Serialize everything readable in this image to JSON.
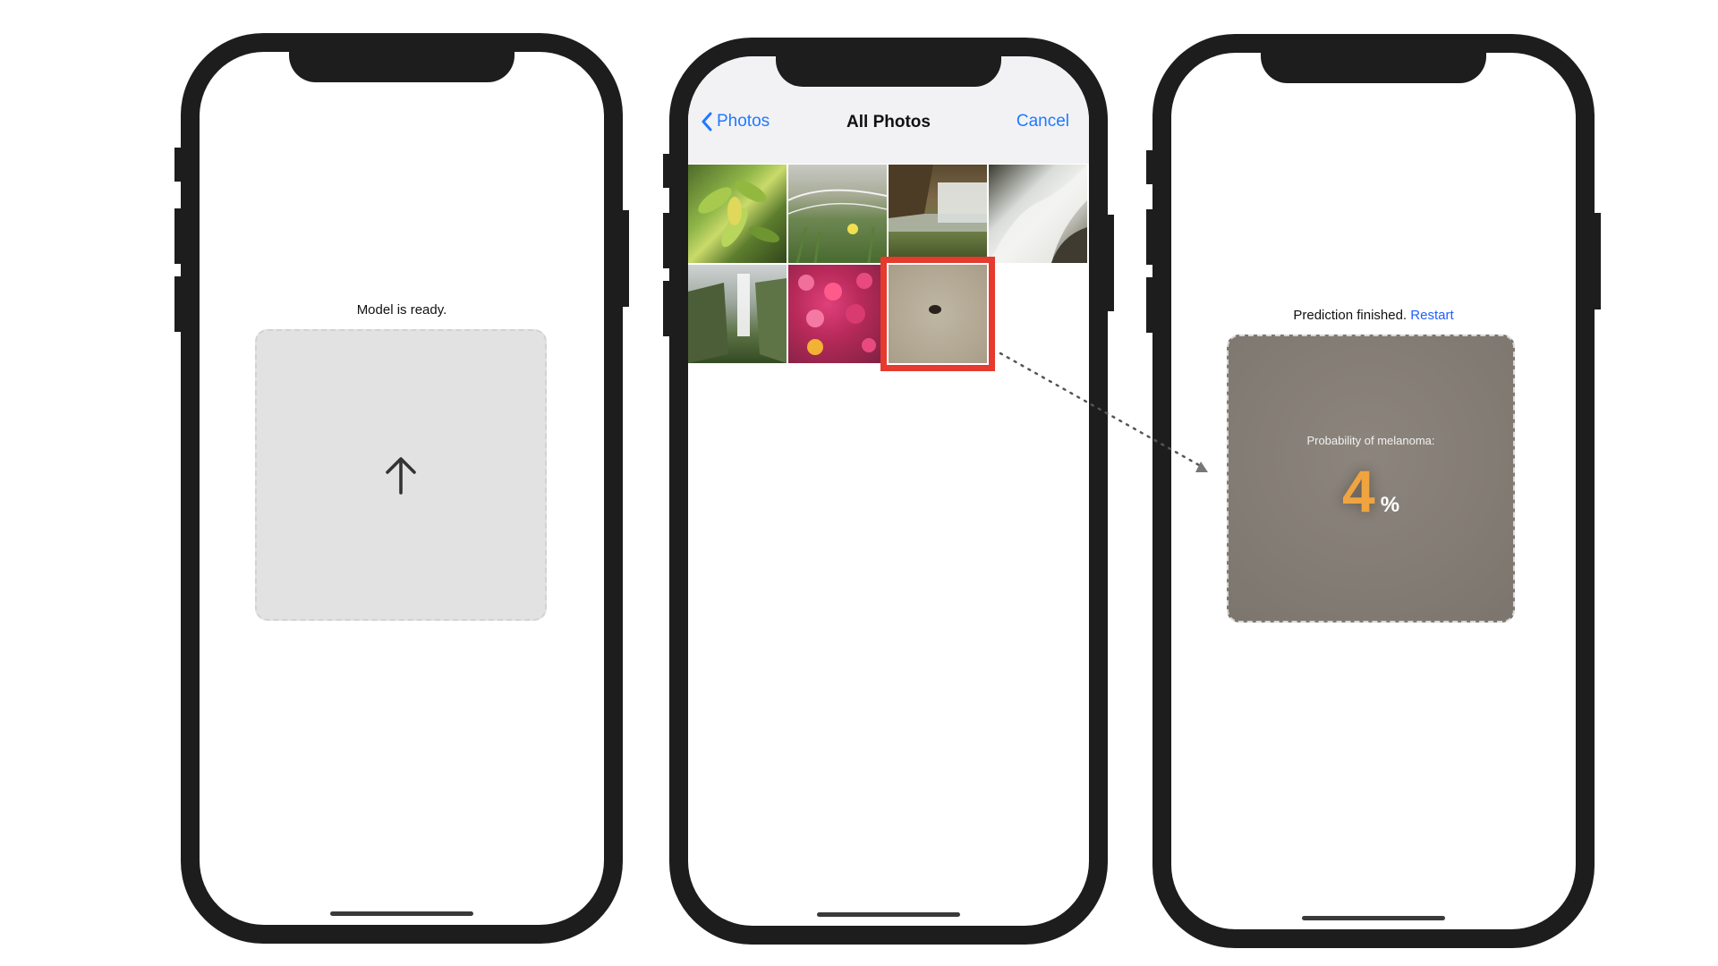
{
  "screen1": {
    "status": "Model is ready."
  },
  "screen2": {
    "back_label": "Photos",
    "title": "All Photos",
    "cancel_label": "Cancel",
    "thumbnails": [
      "plant",
      "meadow",
      "waterfall-cliff",
      "waterfall-rocks",
      "waterfall-mist",
      "flowers",
      "skin-lesion"
    ],
    "selected": "skin-lesion",
    "selection_color": "#e53a2d"
  },
  "screen3": {
    "status": "Prediction finished.",
    "restart_label": "Restart",
    "probability_label": "Probability of melanoma:",
    "probability_value": "4",
    "probability_unit": "%"
  },
  "colors": {
    "link": "#1f7aff",
    "restart_link": "#1f5fff",
    "accent_value": "#f0a440",
    "phone_frame": "#1d1d1d"
  }
}
